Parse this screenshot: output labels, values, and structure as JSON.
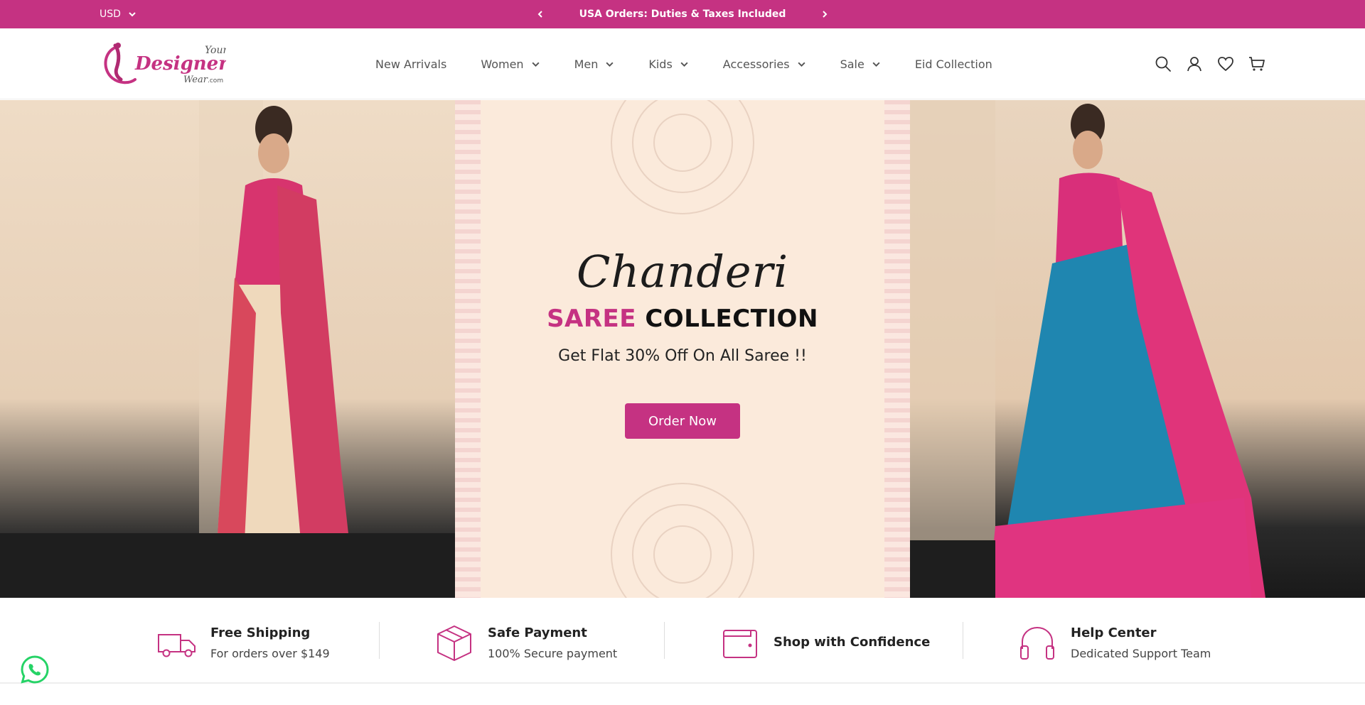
{
  "topbar": {
    "currency": "USD",
    "announcement": "USA Orders: Duties & Taxes Included"
  },
  "brand": {
    "logo_line1": "Your",
    "logo_line2": "Designer",
    "logo_line3": "Wear",
    "logo_suffix": ".com"
  },
  "nav": {
    "items": [
      {
        "label": "New Arrivals",
        "dropdown": false
      },
      {
        "label": "Women",
        "dropdown": true
      },
      {
        "label": "Men",
        "dropdown": true
      },
      {
        "label": "Kids",
        "dropdown": true
      },
      {
        "label": "Accessories",
        "dropdown": true
      },
      {
        "label": "Sale",
        "dropdown": true
      },
      {
        "label": "Eid Collection",
        "dropdown": false
      }
    ]
  },
  "header_icons": [
    "search-icon",
    "account-icon",
    "wishlist-icon",
    "cart-icon"
  ],
  "hero": {
    "script_title": "Chanderi",
    "title_highlight": "SAREE",
    "title_rest": "COLLECTION",
    "subtitle": "Get Flat 30% Off On All Saree !!",
    "cta": "Order Now"
  },
  "features": [
    {
      "icon": "truck-icon",
      "title": "Free Shipping",
      "subtitle": "For orders over $149"
    },
    {
      "icon": "box-icon",
      "title": "Safe Payment",
      "subtitle": "100% Secure payment"
    },
    {
      "icon": "wallet-icon",
      "title": "Shop with Confidence",
      "subtitle": ""
    },
    {
      "icon": "headphones-icon",
      "title": "Help Center",
      "subtitle": "Dedicated Support Team"
    }
  ],
  "colors": {
    "brand_pink": "#c53282",
    "hero_background": "#fbeadb",
    "whatsapp_green": "#25d366"
  }
}
